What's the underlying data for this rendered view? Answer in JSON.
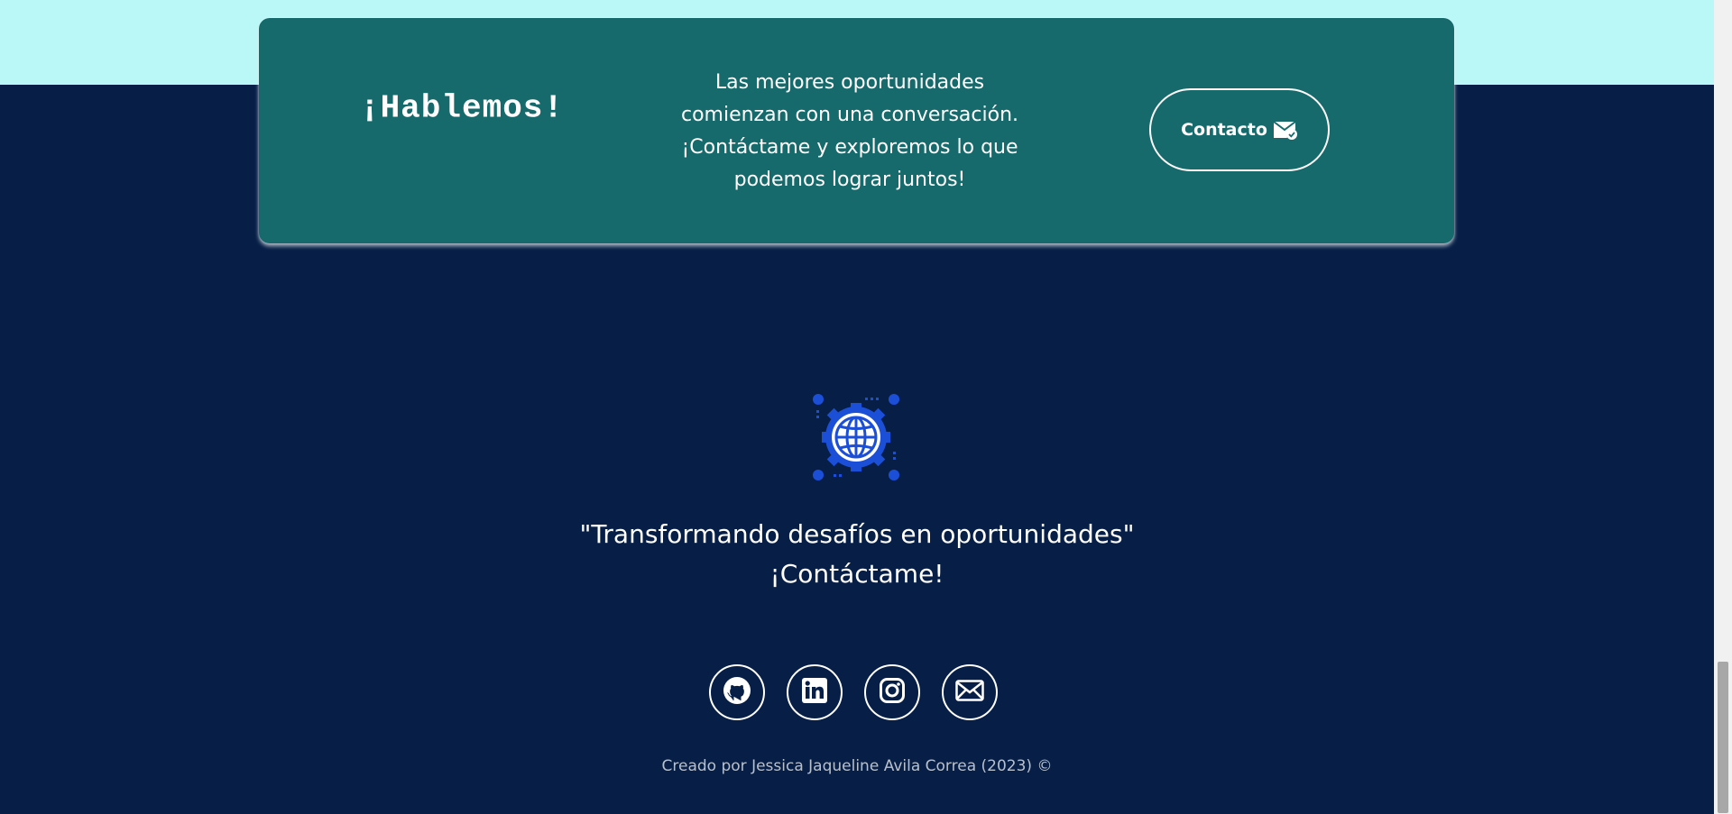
{
  "cta": {
    "title": "¡Hablemos!",
    "text_lines": [
      "Las mejores oportunidades",
      "comienzan con una conversación.",
      "¡Contáctame y exploremos lo que",
      "podemos lograr juntos!"
    ],
    "button_label": "Contacto",
    "button_icon": "mail-check-icon"
  },
  "footer": {
    "logo_icon": "globe-gear-icon",
    "tagline": "\"Transformando desafíos en oportunidades\"",
    "tagline_sub": "¡Contáctame!",
    "socials": [
      {
        "name": "GitHub",
        "icon": "github-icon"
      },
      {
        "name": "LinkedIn",
        "icon": "linkedin-icon"
      },
      {
        "name": "Instagram",
        "icon": "instagram-icon"
      },
      {
        "name": "Email",
        "icon": "mail-icon"
      }
    ],
    "credit": "Creado por Jessica Jaqueline Avila Correa (2023) ©"
  },
  "colors": {
    "top_band": "#baf8f8",
    "background": "#071f47",
    "card": "#166a6c",
    "text": "#ffffff",
    "credit_text": "#b8c0cc",
    "logo_blue": "#1c4fd8"
  }
}
